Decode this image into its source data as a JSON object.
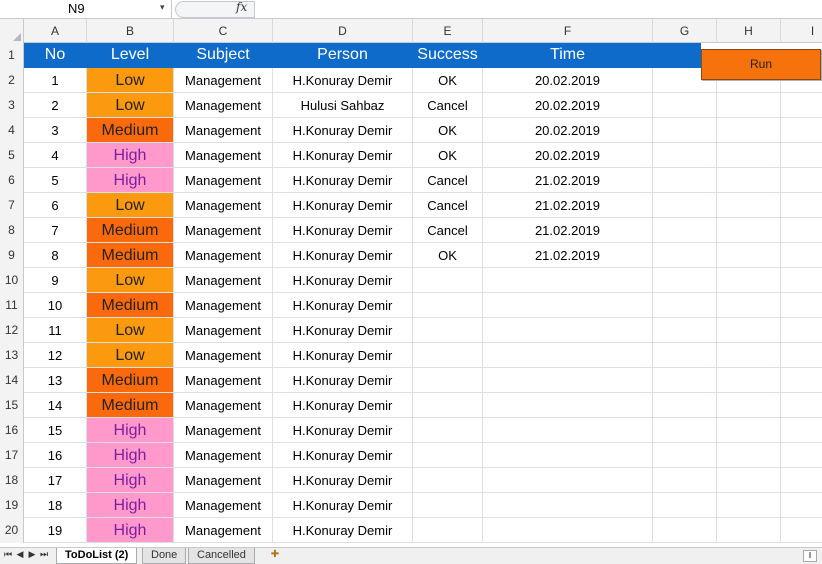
{
  "formula_bar": {
    "name_box": "N9",
    "name_box_arrow": "▾",
    "fx_label": "fx",
    "formula": ""
  },
  "column_headers": [
    "A",
    "B",
    "C",
    "D",
    "E",
    "F",
    "G",
    "H",
    "I"
  ],
  "header_row": {
    "row_number": "1",
    "no": "No",
    "level": "Level",
    "subject": "Subject",
    "person": "Person",
    "success": "Success",
    "time": "Time"
  },
  "rows": [
    {
      "row": "2",
      "no": "1",
      "level": "Low",
      "subject": "Management",
      "person": "H.Konuray Demir",
      "success": "OK",
      "time": "20.02.2019"
    },
    {
      "row": "3",
      "no": "2",
      "level": "Low",
      "subject": "Management",
      "person": "Hulusi Sahbaz",
      "success": "Cancel",
      "time": "20.02.2019"
    },
    {
      "row": "4",
      "no": "3",
      "level": "Medium",
      "subject": "Management",
      "person": "H.Konuray Demir",
      "success": "OK",
      "time": "20.02.2019"
    },
    {
      "row": "5",
      "no": "4",
      "level": "High",
      "subject": "Management",
      "person": "H.Konuray Demir",
      "success": "OK",
      "time": "20.02.2019"
    },
    {
      "row": "6",
      "no": "5",
      "level": "High",
      "subject": "Management",
      "person": "H.Konuray Demir",
      "success": "Cancel",
      "time": "21.02.2019"
    },
    {
      "row": "7",
      "no": "6",
      "level": "Low",
      "subject": "Management",
      "person": "H.Konuray Demir",
      "success": "Cancel",
      "time": "21.02.2019"
    },
    {
      "row": "8",
      "no": "7",
      "level": "Medium",
      "subject": "Management",
      "person": "H.Konuray Demir",
      "success": "Cancel",
      "time": "21.02.2019"
    },
    {
      "row": "9",
      "no": "8",
      "level": "Medium",
      "subject": "Management",
      "person": "H.Konuray Demir",
      "success": "OK",
      "time": "21.02.2019"
    },
    {
      "row": "10",
      "no": "9",
      "level": "Low",
      "subject": "Management",
      "person": "H.Konuray Demir",
      "success": "",
      "time": ""
    },
    {
      "row": "11",
      "no": "10",
      "level": "Medium",
      "subject": "Management",
      "person": "H.Konuray Demir",
      "success": "",
      "time": ""
    },
    {
      "row": "12",
      "no": "11",
      "level": "Low",
      "subject": "Management",
      "person": "H.Konuray Demir",
      "success": "",
      "time": ""
    },
    {
      "row": "13",
      "no": "12",
      "level": "Low",
      "subject": "Management",
      "person": "H.Konuray Demir",
      "success": "",
      "time": ""
    },
    {
      "row": "14",
      "no": "13",
      "level": "Medium",
      "subject": "Management",
      "person": "H.Konuray Demir",
      "success": "",
      "time": ""
    },
    {
      "row": "15",
      "no": "14",
      "level": "Medium",
      "subject": "Management",
      "person": "H.Konuray Demir",
      "success": "",
      "time": ""
    },
    {
      "row": "16",
      "no": "15",
      "level": "High",
      "subject": "Management",
      "person": "H.Konuray Demir",
      "success": "",
      "time": ""
    },
    {
      "row": "17",
      "no": "16",
      "level": "High",
      "subject": "Management",
      "person": "H.Konuray Demir",
      "success": "",
      "time": ""
    },
    {
      "row": "18",
      "no": "17",
      "level": "High",
      "subject": "Management",
      "person": "H.Konuray Demir",
      "success": "",
      "time": ""
    },
    {
      "row": "19",
      "no": "18",
      "level": "High",
      "subject": "Management",
      "person": "H.Konuray Demir",
      "success": "",
      "time": ""
    },
    {
      "row": "20",
      "no": "19",
      "level": "High",
      "subject": "Management",
      "person": "H.Konuray Demir",
      "success": "",
      "time": ""
    }
  ],
  "run_button": {
    "label": "Run",
    "color": "#f6720c"
  },
  "level_colors": {
    "Low": "#fb9a0f",
    "Medium": "#fa6a0c",
    "High": "#ff99cc"
  },
  "header_color": "#0e6bc9",
  "sheet_tabs": [
    {
      "label": "ToDoList (2)",
      "active": true
    },
    {
      "label": "Done",
      "active": false
    },
    {
      "label": "Cancelled",
      "active": false
    }
  ],
  "nav_buttons": {
    "first": "⏮",
    "prev": "◀",
    "next": "▶",
    "last": "⏭"
  },
  "icons": {
    "new_sheet": "new-sheet-icon",
    "fx": "function-icon"
  }
}
